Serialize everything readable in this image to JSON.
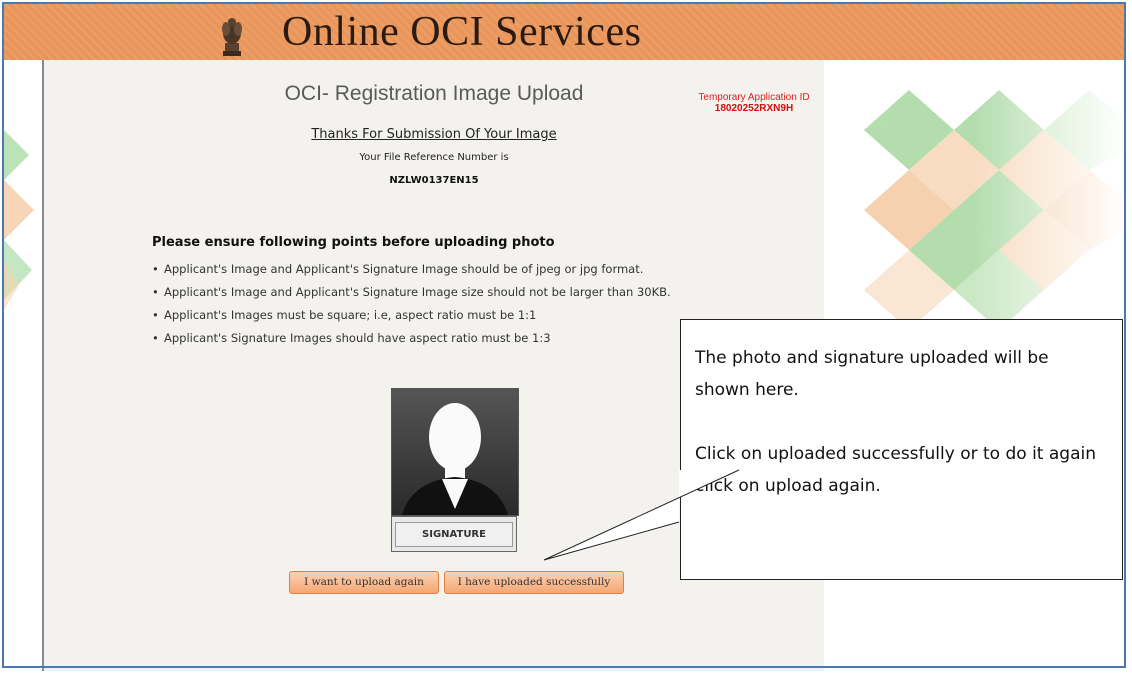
{
  "header": {
    "title": "Online OCI Services",
    "emblem_icon": "national-emblem-icon"
  },
  "main": {
    "page_title": "OCI- Registration Image Upload",
    "temp_id_label": "Temporary Application ID",
    "temp_id_value": "18020252RXN9H",
    "thanks_text": "Thanks For Submission Of Your Image",
    "ref_label": "Your File Reference Number is",
    "ref_value": "NZLW0137EN15",
    "points_heading": "Please ensure following points before uploading photo",
    "points": [
      "Applicant's Image and Applicant's Signature Image should be of jpeg or jpg format.",
      "Applicant's Image and Applicant's Signature Image size should not be larger than 30KB.",
      "Applicant's Images must be square; i.e, aspect ratio must be 1:1",
      "Applicant's Signature Images should have aspect ratio must be 1:3"
    ],
    "signature_label": "SIGNATURE",
    "upload_again_label": "I want to upload again",
    "uploaded_success_label": "I have uploaded successfully"
  },
  "callout": {
    "paragraph1": "The photo and signature uploaded will be shown here.",
    "paragraph2": " Click on uploaded successfully or to do it again click on upload again."
  },
  "colors": {
    "header_bg": "#e9985e",
    "accent_red": "#e02020",
    "button_bg": "#f5a673",
    "panel_bg": "#f3f2ee"
  }
}
